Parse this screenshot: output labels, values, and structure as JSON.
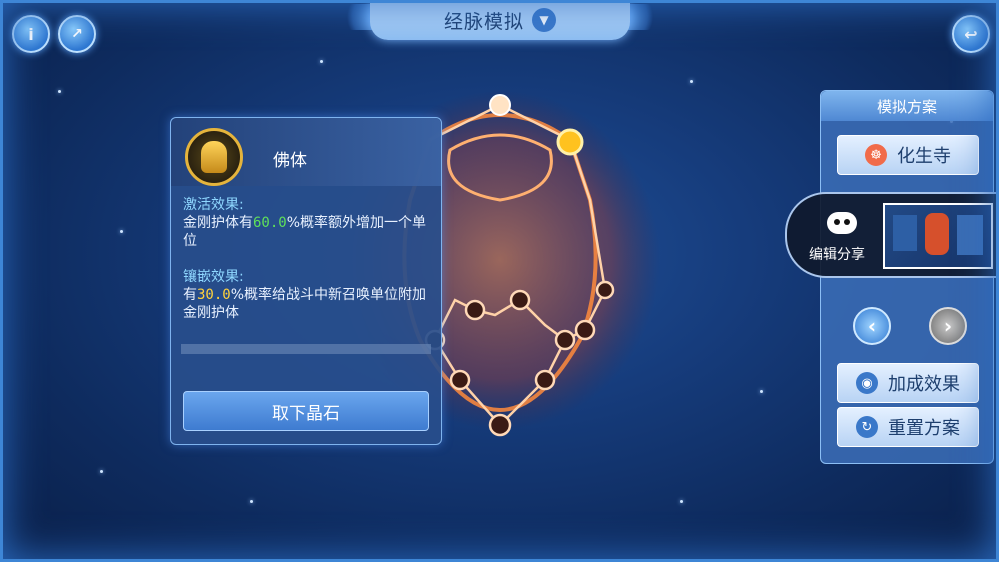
{
  "header": {
    "title": "经脉模拟",
    "dropdown_icon": "chevron-down-icon"
  },
  "top_left": {
    "info_icon": "info-icon",
    "share_icon": "edit-share-icon"
  },
  "top_right": {
    "back_icon": "return-arrow-icon"
  },
  "info_panel": {
    "name": "佛体",
    "activate_label": "激活效果:",
    "activate_text_pre": "金刚护体有",
    "activate_value": "60.0",
    "activate_text_post": "%概率额外增加一个单位",
    "inlay_label": "镶嵌效果:",
    "inlay_text_pre": "有",
    "inlay_value": "30.0",
    "inlay_text_post": "%概率给战斗中新召唤单位附加金刚护体",
    "remove_button": "取下晶石"
  },
  "right_panel": {
    "title": "模拟方案",
    "sect_button": "化生寺",
    "bonus_button": "加成效果",
    "reset_button": "重置方案"
  },
  "share_popup": {
    "label": "编辑分享"
  },
  "colors": {
    "accent": "#3e7bd0",
    "green_value": "#5fe05a",
    "yellow_value": "#ffd23c",
    "constellation": "#ff6a2a"
  }
}
